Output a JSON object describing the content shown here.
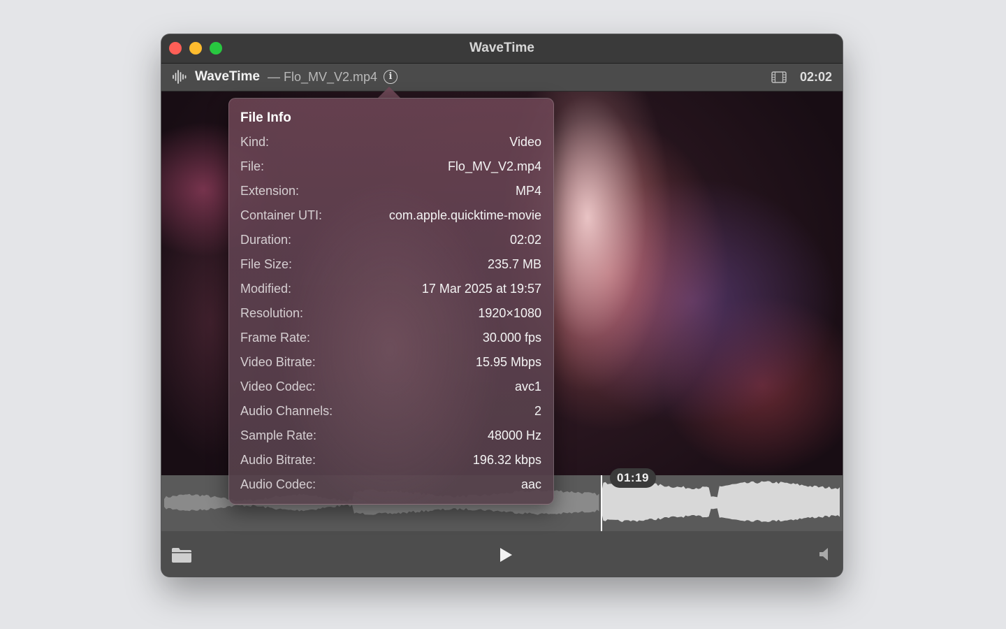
{
  "window": {
    "title": "WaveTime"
  },
  "toolbar": {
    "app_name": "WaveTime",
    "file_label": "— Flo_MV_V2.mp4",
    "info_glyph": "i",
    "duration": "02:02"
  },
  "file_info": {
    "title": "File Info",
    "rows": [
      {
        "label": "Kind:",
        "value": "Video"
      },
      {
        "label": "File:",
        "value": "Flo_MV_V2.mp4"
      },
      {
        "label": "Extension:",
        "value": "MP4"
      },
      {
        "label": "Container UTI:",
        "value": "com.apple.quicktime-movie"
      },
      {
        "label": "Duration:",
        "value": "02:02"
      },
      {
        "label": "File Size:",
        "value": "235.7 MB"
      },
      {
        "label": "Modified:",
        "value": "17 Mar 2025 at 19:57"
      },
      {
        "label": "Resolution:",
        "value": "1920×1080"
      },
      {
        "label": "Frame Rate:",
        "value": "30.000 fps"
      },
      {
        "label": "Video Bitrate:",
        "value": "15.95 Mbps"
      },
      {
        "label": "Video Codec:",
        "value": "avc1"
      },
      {
        "label": "Audio Channels:",
        "value": "2"
      },
      {
        "label": "Sample Rate:",
        "value": "48000 Hz"
      },
      {
        "label": "Audio Bitrate:",
        "value": "196.32 kbps"
      },
      {
        "label": "Audio Codec:",
        "value": "aac"
      }
    ]
  },
  "playback": {
    "current_time": "01:19",
    "progress": 0.645
  },
  "colors": {
    "close": "#fe5f57",
    "minimize": "#febc2e",
    "maximize": "#28c840",
    "waveform_played": "#8a8a8a",
    "waveform_unplayed": "#d8d8d8"
  },
  "icons": {
    "app": "waveform-icon",
    "info": "info-circle-icon",
    "duration": "film-icon",
    "open": "folder-icon",
    "play": "play-icon",
    "volume": "speaker-icon"
  }
}
